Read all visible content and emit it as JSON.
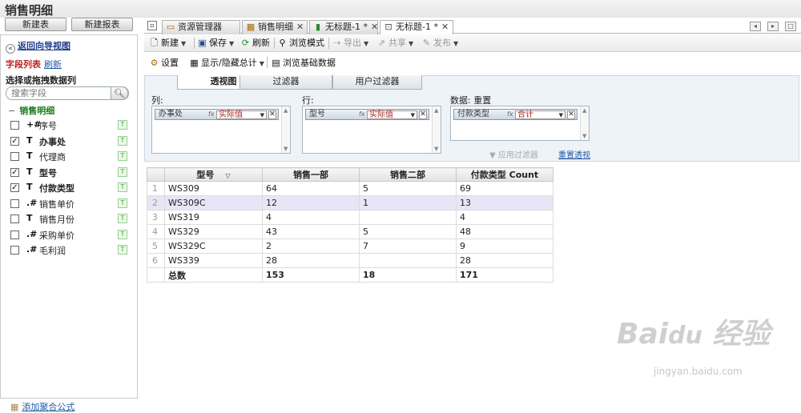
{
  "app": {
    "title": "销售明细"
  },
  "left": {
    "new_table_btn": "新建表",
    "new_report_btn": "新建报表",
    "back_link": "返回向导视图",
    "field_list_title": "字段列表",
    "refresh_link": "刷新",
    "select_label": "选择或拖拽数据列",
    "search_placeholder": "搜索字段",
    "tree_root": "销售明细",
    "fields": [
      {
        "type": "+#",
        "name": "序号",
        "checked": false
      },
      {
        "type": "T",
        "name": "办事处",
        "checked": true
      },
      {
        "type": "T",
        "name": "代理商",
        "checked": false
      },
      {
        "type": "T",
        "name": "型号",
        "checked": true
      },
      {
        "type": "T",
        "name": "付款类型",
        "checked": true
      },
      {
        "type": ".#",
        "name": "销售单价",
        "checked": false
      },
      {
        "type": "T",
        "name": "销售月份",
        "checked": false
      },
      {
        "type": ".#",
        "name": "采购单价",
        "checked": false
      },
      {
        "type": ".#",
        "name": "毛利润",
        "checked": false
      }
    ],
    "add_formula": "添加聚合公式"
  },
  "tabs": [
    {
      "label": "资源管理器",
      "closable": false
    },
    {
      "label": "销售明细",
      "closable": true
    },
    {
      "label": "无标题-1 *",
      "closable": true
    },
    {
      "label": "无标题-1 *",
      "closable": true
    }
  ],
  "toolbar": {
    "new": "新建",
    "save": "保存",
    "refresh": "刷新",
    "browse_mode": "浏览模式",
    "export": "导出",
    "share": "共享",
    "publish": "发布"
  },
  "toolbar2": {
    "settings": "设置",
    "show_hide_totals": "显示/隐藏总计",
    "browse_base_data": "浏览基础数据"
  },
  "pivot": {
    "tabs": [
      "透视图",
      "过滤器",
      "用户过滤器"
    ],
    "columns_label": "列:",
    "rows_label": "行:",
    "data_label": "数据: 重置",
    "columns_pill": {
      "name": "办事处",
      "agg": "实际值"
    },
    "rows_pill": {
      "name": "型号",
      "agg": "实际值"
    },
    "data_pill": {
      "name": "付款类型",
      "agg": "合计"
    },
    "apply_filter": "应用过滤器",
    "reset_pivot": "重置透视"
  },
  "grid": {
    "headers": [
      "型号",
      "销售一部",
      "销售二部",
      "付款类型 Count"
    ],
    "rows": [
      {
        "n": "1",
        "model": "WS309",
        "d1": "64",
        "d2": "5",
        "count": "69"
      },
      {
        "n": "2",
        "model": "WS309C",
        "d1": "12",
        "d2": "1",
        "count": "13"
      },
      {
        "n": "3",
        "model": "WS319",
        "d1": "4",
        "d2": "",
        "count": "4"
      },
      {
        "n": "4",
        "model": "WS329",
        "d1": "43",
        "d2": "5",
        "count": "48"
      },
      {
        "n": "5",
        "model": "WS329C",
        "d1": "2",
        "d2": "7",
        "count": "9"
      },
      {
        "n": "6",
        "model": "WS339",
        "d1": "28",
        "d2": "",
        "count": "28"
      }
    ],
    "total": {
      "label": "总数",
      "d1": "153",
      "d2": "18",
      "count": "171"
    }
  },
  "watermark": {
    "main": "Bai 经验",
    "sub": "jingyan.baidu.com"
  }
}
